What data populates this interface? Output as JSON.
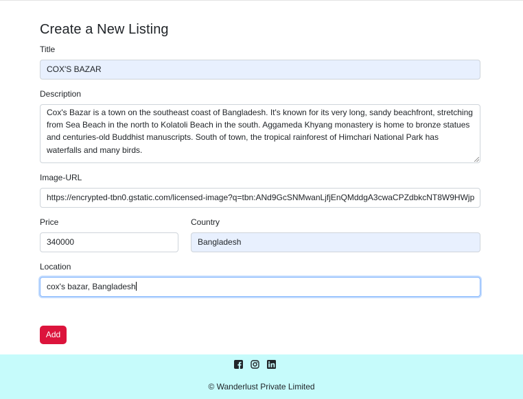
{
  "page": {
    "heading": "Create a New Listing"
  },
  "form": {
    "title": {
      "label": "Title",
      "value": "COX'S BAZAR"
    },
    "description": {
      "label": "Description",
      "value": "Cox's Bazar is a town on the southeast coast of Bangladesh. It's known for its very long, sandy beachfront, stretching from Sea Beach in the north to Kolatoli Beach in the south. Aggameda Khyang monastery is home to bronze statues and centuries-old Buddhist manuscripts. South of town, the tropical rainforest of Himchari National Park has waterfalls and many birds."
    },
    "image_url": {
      "label": "Image-URL",
      "value": "https://encrypted-tbn0.gstatic.com/licensed-image?q=tbn:ANd9GcSNMwanLjfjEnQMddgA3cwaCPZdbkcNT8W9HWjp"
    },
    "price": {
      "label": "Price",
      "value": "340000"
    },
    "country": {
      "label": "Country",
      "value": "Bangladesh"
    },
    "location": {
      "label": "Location",
      "value": "cox's bazar, Bangladesh"
    },
    "submit_label": "Add"
  },
  "footer": {
    "icons": [
      "facebook-icon",
      "instagram-icon",
      "linkedin-icon"
    ],
    "copyright": "© Wanderlust Private Limited"
  },
  "colors": {
    "accent": "#dc143c",
    "footer_bg": "#c6fbfb",
    "autofill_bg": "#e8f0fe"
  }
}
